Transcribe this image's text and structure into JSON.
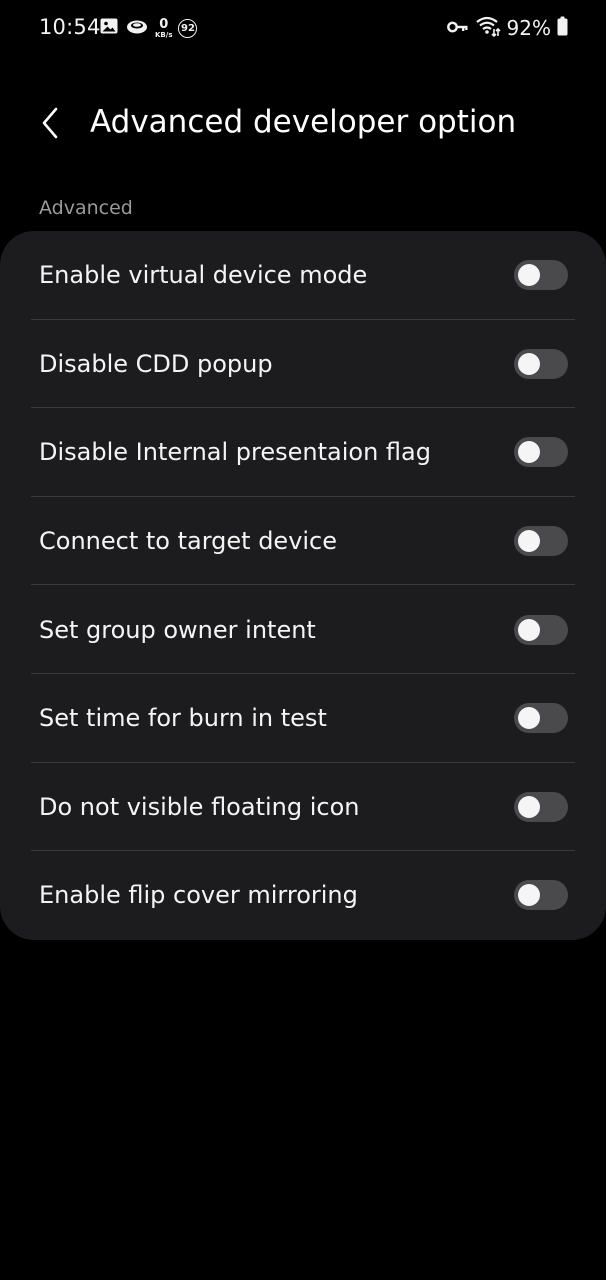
{
  "status_bar": {
    "time": "10:54",
    "speed_value": "0",
    "speed_unit": "KB/s",
    "notif_count": "92",
    "battery_percent": "92%",
    "icons": [
      "gallery-icon",
      "cloud-icon",
      "network-speed",
      "notification-count",
      "vpn-key-icon",
      "wifi-icon",
      "battery-icon"
    ]
  },
  "header": {
    "title": "Advanced developer option",
    "back_icon": "chevron-left-icon"
  },
  "section": {
    "label": "Advanced"
  },
  "settings": [
    {
      "label": "Enable virtual device mode",
      "enabled": false
    },
    {
      "label": "Disable CDD popup",
      "enabled": false
    },
    {
      "label": "Disable Internal presentaion flag",
      "enabled": false
    },
    {
      "label": "Connect to target device",
      "enabled": false
    },
    {
      "label": "Set group owner intent",
      "enabled": false
    },
    {
      "label": "Set time for burn in test",
      "enabled": false
    },
    {
      "label": "Do not visible floating icon",
      "enabled": false
    },
    {
      "label": "Enable flip cover mirroring",
      "enabled": false
    }
  ],
  "colors": {
    "background": "#000000",
    "card": "#1c1c1e",
    "toggle_off_track": "#4a4a4c",
    "toggle_knob": "#f5f5f5",
    "section_label": "#9a9a9a"
  }
}
